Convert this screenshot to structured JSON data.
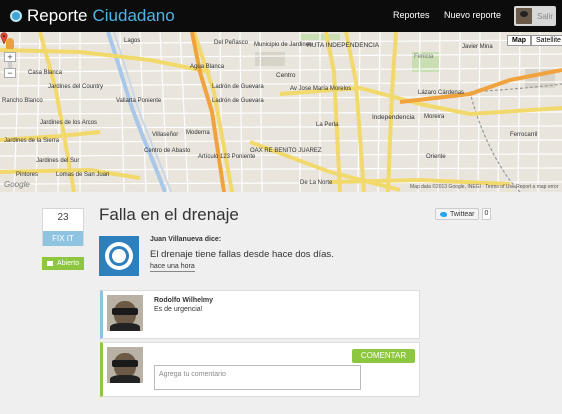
{
  "header": {
    "brand_primary": "Reporte",
    "brand_secondary": "Ciudadano",
    "nav_reportes": "Reportes",
    "nav_nuevo": "Nuevo reporte",
    "logout_label": "Salir"
  },
  "map": {
    "type_map": "Map",
    "type_satellite": "Satellite",
    "zoom_in": "+",
    "zoom_out": "−",
    "logo": "Google",
    "copyright": "Map data ©2013 Google, INEGI · Terms of Use   Report a map error",
    "labels": {
      "l1": "Lagos",
      "l2": "Del Peñasco",
      "l3": "Municipio de Jardines",
      "l4": "Agua Blanca",
      "l5": "Casa Blanca",
      "l6": "Jardines del Country",
      "l7": "Rancho Blanco",
      "l8": "Ladrón de Guevara",
      "l9": "Vallarta Poniente",
      "l10": "Jardines de los Arcos",
      "l11": "Ladrón de Guevara",
      "l12": "Moderna",
      "l13": "Villaseñor",
      "l14": "Centro de Abasto",
      "l15": "Artículo 123 Poniente",
      "l16": "OAX RE BENITO JUAREZ",
      "l17": "RUTA INDEPENDENCIA",
      "l18": "Centro",
      "l19": "Independencia",
      "l20": "Moreira",
      "l21": "La Perla",
      "l22": "Jardines de la Sierra",
      "l23": "Lomas de San Juan",
      "l24": "Jardines del Sur",
      "l25": "Pintores",
      "l26": "Ferrocarril",
      "l27": "Oriente",
      "l28": "De La Norte",
      "l29": "Av Jose María Morelos",
      "l30": "Lázaro Cárdenas",
      "l31": "Javier Mina",
      "l32": "Fenicia"
    }
  },
  "report": {
    "votes": "23",
    "fix_label": "FIX IT",
    "status": "Abierto",
    "title": "Falla en el drenaje",
    "tweet_label": "Twittear",
    "tweet_count": "0",
    "author": "Juan Villanueva dice:",
    "body": "El drenaje tiene fallas desde hace dos días.",
    "time": "hace una hora"
  },
  "comments": [
    {
      "name": "Rodolfo Wilhelmy",
      "text": "Es de urgencia!"
    }
  ],
  "new_comment": {
    "placeholder": "Agrega tu comentario",
    "submit": "COMENTAR"
  },
  "colors": {
    "topbar": "#0c0c0c",
    "brand_accent": "#4fb3e3",
    "fix_blue": "#8ec4e0",
    "green": "#8dc63f",
    "logo_blue": "#2e7fbd"
  },
  "icons": [
    "brand-logo-icon",
    "pegman-icon",
    "map-pin-icon",
    "flag-icon",
    "twitter-bird-icon"
  ]
}
